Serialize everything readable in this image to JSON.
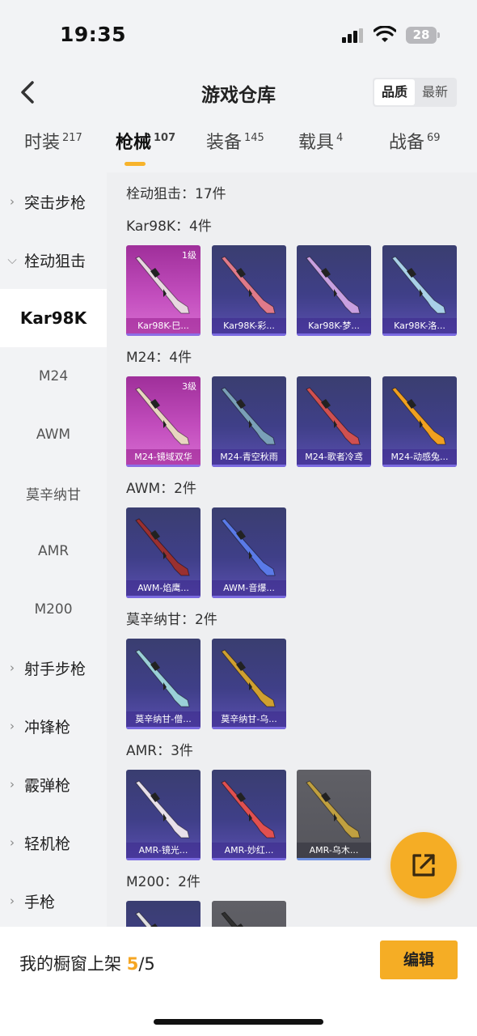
{
  "status": {
    "time": "19:35",
    "battery": "28"
  },
  "header": {
    "title": "游戏仓库",
    "sort_options": [
      "品质",
      "最新"
    ]
  },
  "tabs": [
    {
      "label": "时装",
      "count": "217"
    },
    {
      "label": "枪械",
      "count": "107"
    },
    {
      "label": "装备",
      "count": "145"
    },
    {
      "label": "载具",
      "count": "4"
    },
    {
      "label": "战备",
      "count": "69"
    }
  ],
  "sidebar": {
    "assault": "突击步枪",
    "bolt": "栓动狙击",
    "subs": [
      "Kar98K",
      "M24",
      "AWM",
      "莫辛纳甘",
      "AMR",
      "M200"
    ],
    "dmr": "射手步枪",
    "smg": "冲锋枪",
    "shotgun": "霰弹枪",
    "lmg": "轻机枪",
    "pistol": "手枪"
  },
  "content": {
    "category_total": "栓动狙击：17件",
    "groups": [
      {
        "label": "Kar98K：4件",
        "items": [
          {
            "name": "Kar98K-巳...",
            "level": "1级",
            "rarity": "pink",
            "color": "#e8d8e0"
          },
          {
            "name": "Kar98K-彩...",
            "rarity": "blue",
            "color": "#e07a8a"
          },
          {
            "name": "Kar98K-梦...",
            "rarity": "blue",
            "color": "#c8a0e0"
          },
          {
            "name": "Kar98K-洛...",
            "rarity": "blue",
            "color": "#a8d0e8"
          }
        ]
      },
      {
        "label": "M24：4件",
        "items": [
          {
            "name": "M24-镜域双华",
            "level": "3级",
            "rarity": "pink",
            "color": "#e8d6c0"
          },
          {
            "name": "M24-青空秋雨",
            "rarity": "blue",
            "color": "#7aa0b8"
          },
          {
            "name": "M24-歌者冷鸢",
            "rarity": "blue",
            "color": "#d05050"
          },
          {
            "name": "M24-动感兔...",
            "rarity": "blue",
            "color": "#f0a020"
          }
        ]
      },
      {
        "label": "AWM：2件",
        "items": [
          {
            "name": "AWM-焰鹰...",
            "rarity": "blue",
            "color": "#9a3030"
          },
          {
            "name": "AWM-音爆...",
            "rarity": "blue",
            "color": "#5a7ae8"
          }
        ]
      },
      {
        "label": "莫辛纳甘：2件",
        "items": [
          {
            "name": "莫辛纳甘-僧...",
            "rarity": "blue",
            "color": "#9ad0d8"
          },
          {
            "name": "莫辛纳甘-乌...",
            "rarity": "blue",
            "color": "#d0a030"
          }
        ]
      },
      {
        "label": "AMR：3件",
        "items": [
          {
            "name": "AMR-镜光...",
            "rarity": "blue",
            "color": "#e8e0ea"
          },
          {
            "name": "AMR-妙红...",
            "rarity": "blue",
            "color": "#e05050"
          },
          {
            "name": "AMR-乌木...",
            "rarity": "gray",
            "color": "#c0a040"
          }
        ]
      },
      {
        "label": "M200：2件",
        "items": [
          {
            "name": "",
            "rarity": "blue",
            "color": "#e0e0e0"
          },
          {
            "name": "",
            "rarity": "gray",
            "color": "#303030"
          }
        ]
      }
    ]
  },
  "bottom": {
    "shelf_label": "我的橱窗上架",
    "shelf_current": "5",
    "shelf_total": "/5",
    "edit_label": "编辑"
  },
  "colors": {
    "accent": "#f5ad25",
    "count_highlight": "#f5a623"
  }
}
